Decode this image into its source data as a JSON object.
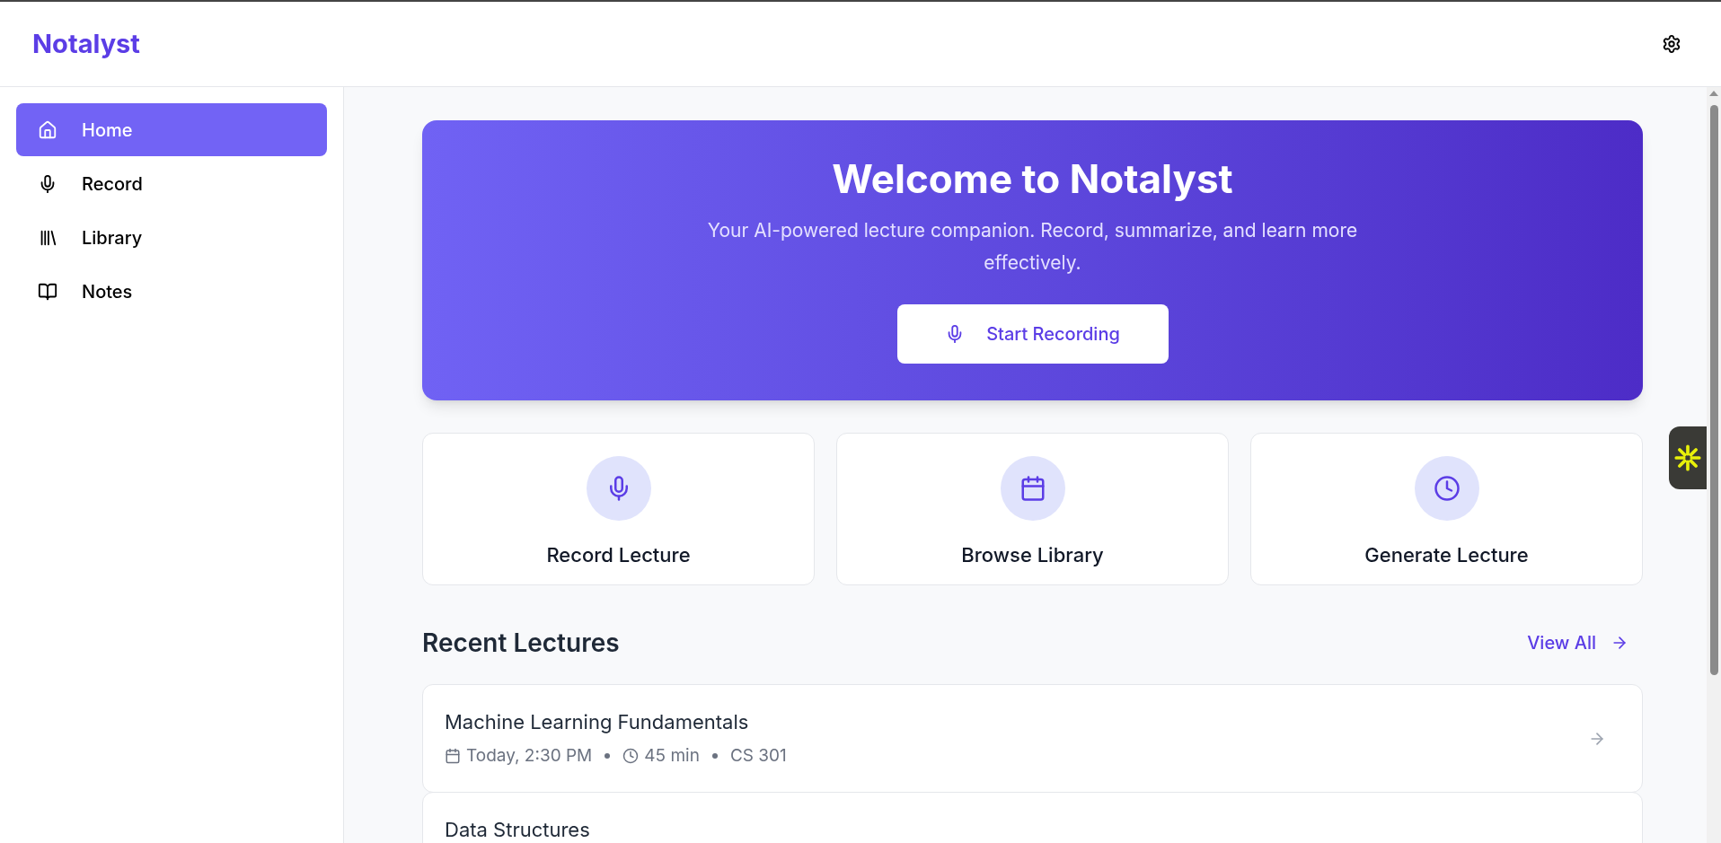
{
  "header": {
    "logo": "Notalyst"
  },
  "sidebar": {
    "items": [
      {
        "label": "Home",
        "selected": true
      },
      {
        "label": "Record",
        "selected": false
      },
      {
        "label": "Library",
        "selected": false
      },
      {
        "label": "Notes",
        "selected": false
      }
    ]
  },
  "hero": {
    "title": "Welcome to Notalyst",
    "subtitle": "Your AI-powered lecture companion. Record, summarize, and learn more effectively.",
    "button": "Start Recording"
  },
  "actions": [
    {
      "label": "Record Lecture"
    },
    {
      "label": "Browse Library"
    },
    {
      "label": "Generate Lecture"
    }
  ],
  "recent": {
    "title": "Recent Lectures",
    "link": "View All",
    "lectures": [
      {
        "title": "Machine Learning Fundamentals",
        "date": "Today, 2:30 PM",
        "duration": "45 min",
        "course": "CS 301"
      },
      {
        "title": "Data Structures"
      }
    ]
  }
}
